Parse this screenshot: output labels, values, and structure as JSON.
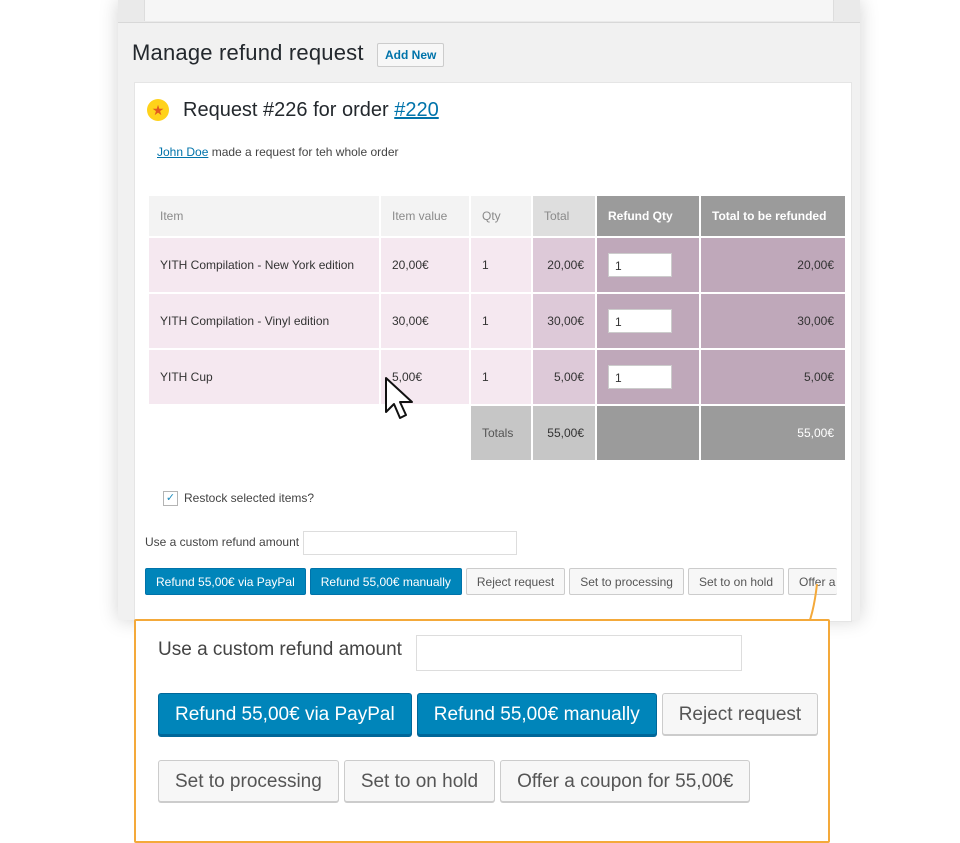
{
  "header": {
    "title": "Manage refund request",
    "add_new_label": "Add New"
  },
  "request": {
    "title_prefix": "Request #226 for order ",
    "order_link": "#220",
    "customer_link": "John Doe",
    "description": " made a request for teh whole order"
  },
  "table": {
    "headers": [
      "Item",
      "Item value",
      "Qty",
      "Total",
      "Refund Qty",
      "Total to be refunded"
    ],
    "rows": [
      {
        "item": "YITH Compilation - New York edition",
        "value": "20,00€",
        "qty": "1",
        "total": "20,00€",
        "refund_qty": "1",
        "refund_total": "20,00€"
      },
      {
        "item": "YITH Compilation - Vinyl edition",
        "value": "30,00€",
        "qty": "1",
        "total": "30,00€",
        "refund_qty": "1",
        "refund_total": "30,00€"
      },
      {
        "item": "YITH Cup",
        "value": "5,00€",
        "qty": "1",
        "total": "5,00€",
        "refund_qty": "1",
        "refund_total": "5,00€"
      }
    ],
    "totals_label": "Totals",
    "totals_value": "55,00€",
    "totals_refund": "55,00€"
  },
  "restock": {
    "label": "Restock selected items?",
    "checked": true
  },
  "custom_amount": {
    "label": "Use a custom refund amount",
    "value": ""
  },
  "actions": {
    "paypal": "Refund 55,00€ via PayPal",
    "manual": "Refund 55,00€ manually",
    "reject": "Reject request",
    "processing": "Set to processing",
    "on_hold": "Set to on hold",
    "coupon_truncated": "Offer a",
    "coupon": "Offer a coupon for 55,00€"
  },
  "colors": {
    "primary_button": "#0085ba",
    "link": "#0073aa",
    "highlight_border": "#f4a93a",
    "row_light": "#f5e8f0",
    "row_dark": "#bfa8ba"
  }
}
